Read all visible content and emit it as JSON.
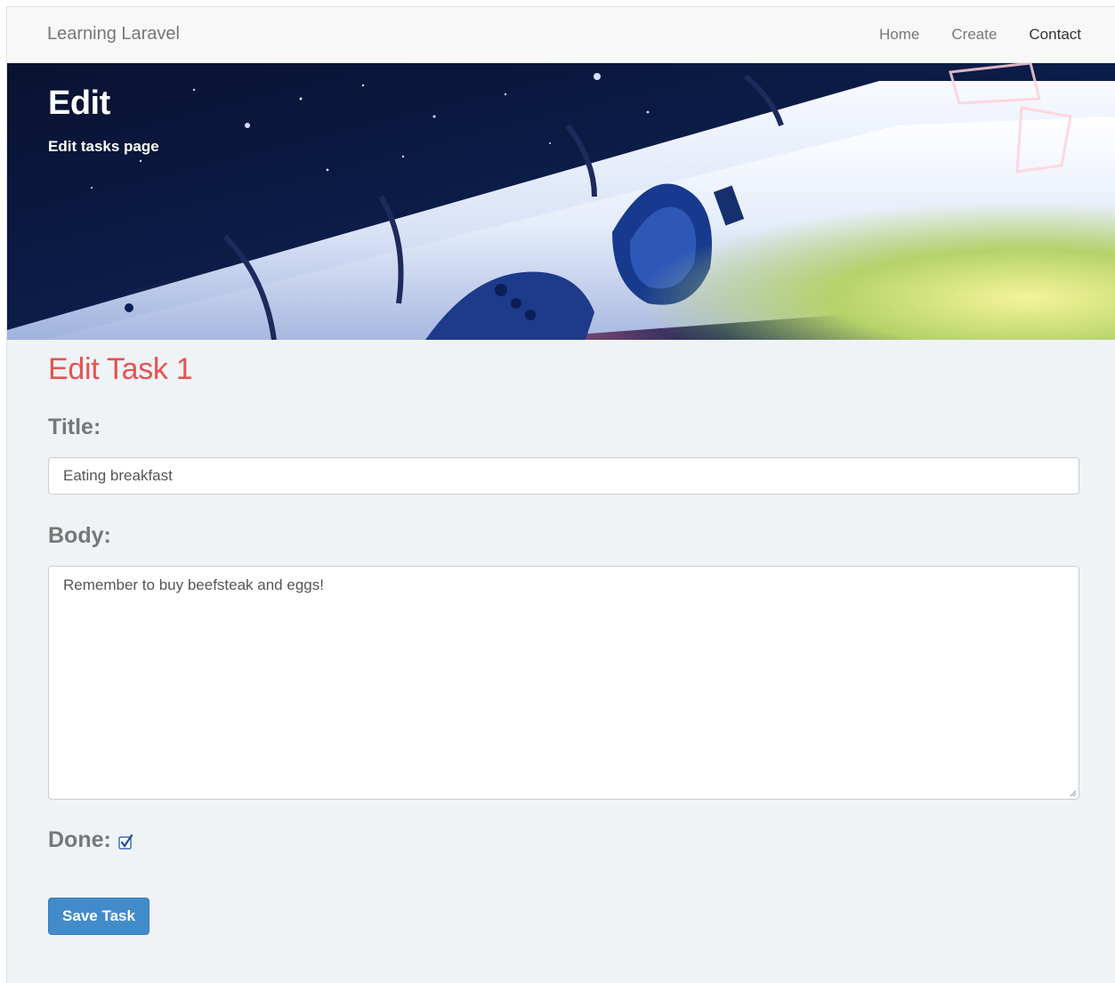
{
  "navbar": {
    "brand": "Learning Laravel",
    "links": [
      {
        "label": "Home",
        "active": false
      },
      {
        "label": "Create",
        "active": false
      },
      {
        "label": "Contact",
        "active": true
      }
    ]
  },
  "hero": {
    "title": "Edit",
    "subtitle": "Edit tasks page",
    "background": "space-shuttle-image"
  },
  "form": {
    "heading": "Edit Task 1",
    "title_label": "Title:",
    "title_value": "Eating breakfast",
    "body_label": "Body:",
    "body_value": "Remember to buy beefsteak and eggs!",
    "done_label": "Done:",
    "done_checked": true,
    "submit_label": "Save Task"
  },
  "colors": {
    "heading": "#e55353",
    "button": "#428bca",
    "label": "#777777",
    "page_background": "#f0f3f6"
  }
}
